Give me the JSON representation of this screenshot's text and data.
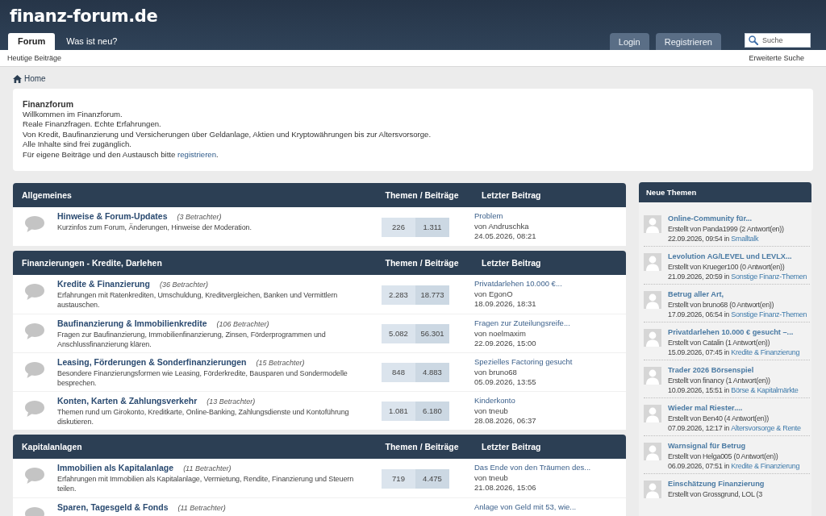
{
  "header": {
    "logo": "finanz-forum.de",
    "tabs": [
      {
        "label": "Forum",
        "selected": true
      },
      {
        "label": "Was ist neu?",
        "selected": false
      }
    ],
    "buttons": [
      "Login",
      "Registrieren"
    ],
    "search": {
      "placeholder": "Suche"
    }
  },
  "subnav": {
    "left_link": "Heutige Beiträge",
    "right_link": "Erweiterte Suche"
  },
  "breadcrumb": [
    "Home"
  ],
  "welcome": {
    "title": "Finanzforum",
    "lines": [
      "Willkommen im Finanzforum.",
      "Reale Finanzfragen. Echte Erfahrungen.",
      "Von Kredit, Baufinanzierung und Versicherungen über Geldanlage, Aktien und Kryptowährungen bis zur Altersvorsorge.",
      "Alle Inhalte sind frei zugänglich."
    ],
    "last_line": {
      "text": "Für eigene Beiträge und den Austausch bitte",
      "link": "registrieren",
      "end": "."
    }
  },
  "categories": [
    {
      "title": "Allgemeines",
      "columns": [
        "Themen / Beiträge",
        "Letzter Beitrag"
      ],
      "forums": [
        {
          "title": "Hinweise & Forum-Updates",
          "viewers": "(3 Betrachter)",
          "description": "Kurzinfos zum Forum, Änderungen, Hinweise der Moderation.",
          "topics": "226",
          "posts": "1.311",
          "last_post": {
            "title": "Problem",
            "author": "von Andruschka",
            "date": "24.05.2026, 08:21"
          }
        }
      ]
    },
    {
      "title": "Finanzierungen - Kredite, Darlehen",
      "columns": [
        "Themen / Beiträge",
        "Letzter Beitrag"
      ],
      "forums": [
        {
          "title": "Kredite & Finanzierung",
          "viewers": "(36 Betrachter)",
          "description": "Erfahrungen mit Ratenkrediten, Umschuldung, Kreditvergleichen, Banken und Vermittlern austauschen.",
          "topics": "2.283",
          "posts": "18.773",
          "last_post": {
            "title": "Privatdarlehen 10.000 €...",
            "author": "von EgonO",
            "date": "18.09.2026, 18:31"
          }
        },
        {
          "title": "Baufinanzierung & Immobilienkredite",
          "viewers": "(106 Betrachter)",
          "description": "Fragen zur Baufinanzierung, Immobilienfinanzierung, Zinsen, Förderprogrammen und Anschlussfinanzierung klären.",
          "topics": "5.082",
          "posts": "56.301",
          "last_post": {
            "title": "Fragen zur Zuteilungsreife...",
            "author": "von noelmaxim",
            "date": "22.09.2026, 15:00"
          }
        },
        {
          "title": "Leasing, Förderungen & Sonderfinanzierungen",
          "viewers": "(15 Betrachter)",
          "description": "Besondere Finanzierungsformen wie Leasing, Förderkredite, Bausparen und Sondermodelle besprechen.",
          "topics": "848",
          "posts": "4.883",
          "last_post": {
            "title": "Spezielles Factoring gesucht",
            "author": "von bruno68",
            "date": "05.09.2026, 13:55"
          }
        },
        {
          "title": "Konten, Karten & Zahlungsverkehr",
          "viewers": "(13 Betrachter)",
          "description": "Themen rund um Girokonto, Kreditkarte, Online-Banking, Zahlungsdienste und Kontoführung diskutieren.",
          "topics": "1.081",
          "posts": "6.180",
          "last_post": {
            "title": "Kinderkonto",
            "author": "von tneub",
            "date": "28.08.2026, 06:37"
          }
        }
      ]
    },
    {
      "title": "Kapitalanlagen",
      "columns": [
        "Themen / Beiträge",
        "Letzter Beitrag"
      ],
      "forums": [
        {
          "title": "Immobilien als Kapitalanlage",
          "viewers": "(11 Betrachter)",
          "description": "Erfahrungen mit Immobilien als Kapitalanlage, Vermietung, Rendite, Finanzierung und Steuern teilen.",
          "topics": "719",
          "posts": "4.475",
          "last_post": {
            "title": "Das Ende von den Träumen des...",
            "author": "von tneub",
            "date": "21.08.2026, 15:06"
          }
        },
        {
          "title": "Sparen, Tagesgeld & Fonds",
          "viewers": "(11 Betrachter)",
          "last_post": {
            "title": "Anlage von Geld mit 53, wie..."
          }
        }
      ]
    }
  ],
  "sidebar": {
    "title": "Neue Themen",
    "items": [
      {
        "title": "Online-Community für...",
        "meta": "Erstellt von Panda1999 (2 Antwort(en))",
        "date": "22.09.2026, 09:54 in",
        "forum": "Smalltalk"
      },
      {
        "title": "Levolution AG/LEVEL und LEVLX...",
        "meta": "Erstellt von Krueger100 (0 Antwort(en))",
        "date": "21.09.2026, 20:59 in",
        "forum": "Sonstige Finanz-Themen"
      },
      {
        "title": "Betrug aller Art,",
        "meta": "Erstellt von bruno68 (0 Antwort(en))",
        "date": "17.09.2026, 06:54 in",
        "forum": "Sonstige Finanz-Themen"
      },
      {
        "title": "Privatdarlehen 10.000 € gesucht –...",
        "meta": "Erstellt von Catalin (1 Antwort(en))",
        "date": "15.09.2026, 07:45 in",
        "forum": "Kredite & Finanzierung"
      },
      {
        "title": "Trader 2026 Börsenspiel",
        "meta": "Erstellt von financy (1 Antwort(en))",
        "date": "10.09.2026, 15:51 in",
        "forum": "Börse & Kapitalmärkte"
      },
      {
        "title": "Wieder mal Riester....",
        "meta": "Erstellt von Ben40 (4 Antwort(en))",
        "date": "07.09.2026, 12:17 in",
        "forum": "Altersvorsorge & Rente"
      },
      {
        "title": "Warnsignal für Betrug",
        "meta": "Erstellt von Helga005 (0 Antwort(en))",
        "date": "06.09.2026, 07:51 in",
        "forum": "Kredite & Finanzierung"
      },
      {
        "title": "Einschätzung Finanzierung",
        "meta": "Erstellt von Grossgrund, LOL (3"
      }
    ]
  }
}
